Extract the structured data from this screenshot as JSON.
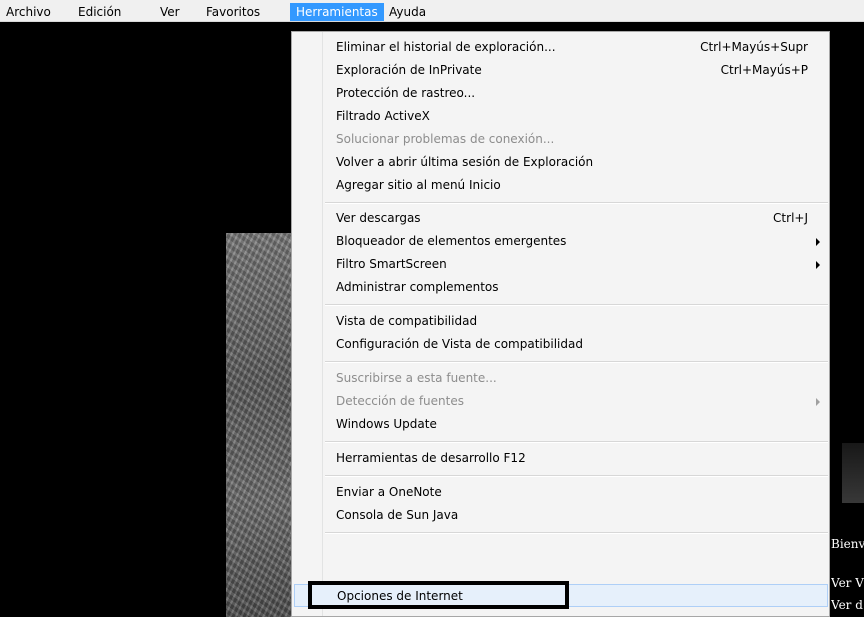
{
  "menubar": {
    "items": [
      {
        "label": "Archivo",
        "active": false
      },
      {
        "label": "Edición",
        "active": false
      },
      {
        "label": "Ver",
        "active": false
      },
      {
        "label": "Favoritos",
        "active": false
      },
      {
        "label": "Herramientas",
        "active": true
      },
      {
        "label": "Ayuda",
        "active": false
      }
    ]
  },
  "menu": {
    "groups": [
      [
        {
          "label": "Eliminar el historial de exploración...",
          "shortcut": "Ctrl+Mayús+Supr",
          "enabled": true
        },
        {
          "label": "Exploración de InPrivate",
          "shortcut": "Ctrl+Mayús+P",
          "enabled": true
        },
        {
          "label": "Protección de rastreo...",
          "enabled": true
        },
        {
          "label": "Filtrado ActiveX",
          "enabled": true
        },
        {
          "label": "Solucionar problemas de conexión...",
          "enabled": false
        },
        {
          "label": "Volver a abrir última sesión de Exploración",
          "enabled": true
        },
        {
          "label": "Agregar sitio al menú Inicio",
          "enabled": true
        }
      ],
      [
        {
          "label": "Ver descargas",
          "shortcut": "Ctrl+J",
          "enabled": true
        },
        {
          "label": "Bloqueador de elementos emergentes",
          "submenu": true,
          "enabled": true
        },
        {
          "label": "Filtro SmartScreen",
          "submenu": true,
          "enabled": true
        },
        {
          "label": "Administrar complementos",
          "enabled": true
        }
      ],
      [
        {
          "label": "Vista de compatibilidad",
          "enabled": true
        },
        {
          "label": "Configuración de Vista de compatibilidad",
          "enabled": true
        }
      ],
      [
        {
          "label": "Suscribirse a esta fuente...",
          "enabled": false
        },
        {
          "label": "Detección de fuentes",
          "submenu": true,
          "enabled": false
        },
        {
          "label": "Windows Update",
          "enabled": true
        }
      ],
      [
        {
          "label": "Herramientas de desarrollo F12",
          "enabled": true
        }
      ],
      [
        {
          "label": "Enviar a OneNote",
          "enabled": true
        },
        {
          "label": "Consola de Sun Java",
          "enabled": true
        }
      ],
      [
        {
          "label": "Opciones de Internet",
          "enabled": true,
          "hovered": true
        }
      ]
    ]
  },
  "page_fragments": {
    "line1": "Bienv",
    "line2": "Ver V",
    "line3": "Ver d"
  },
  "colors": {
    "menu_active_bg": "#3399ff",
    "highlight_box": "#000000"
  }
}
